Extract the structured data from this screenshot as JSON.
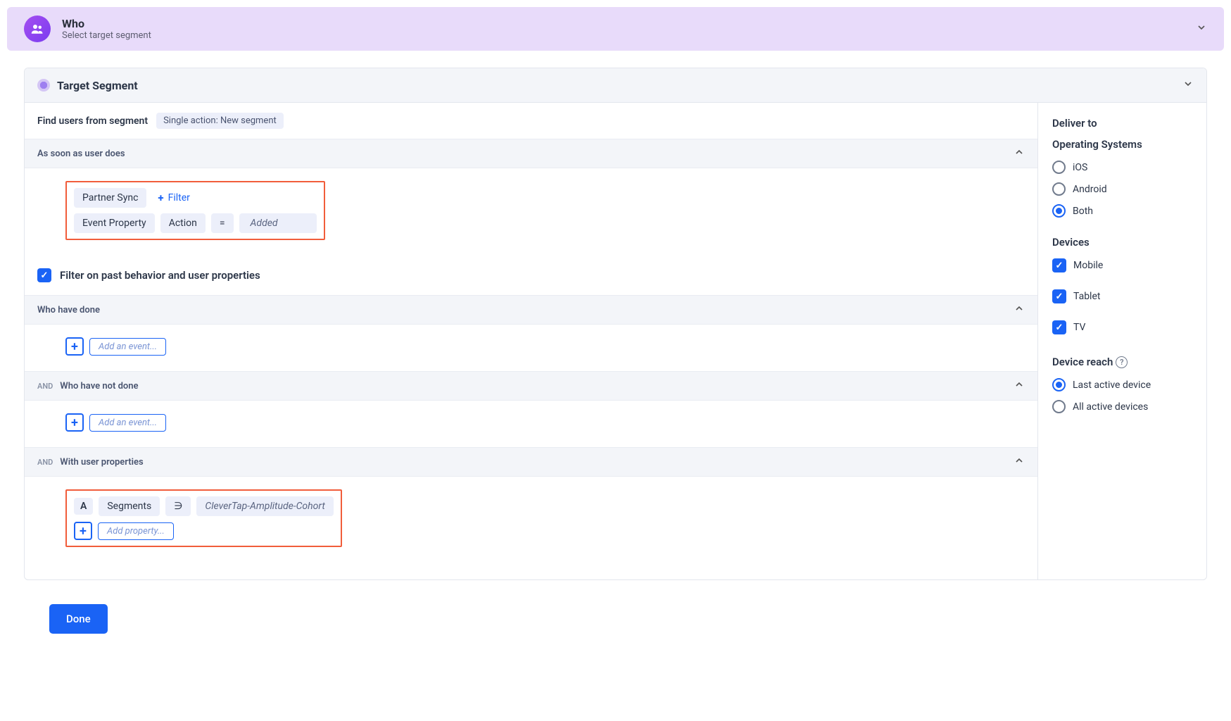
{
  "banner": {
    "title": "Who",
    "subtitle": "Select target segment"
  },
  "target_segment": {
    "title": "Target Segment",
    "find_label": "Find users from segment",
    "find_badge": "Single action: New segment",
    "as_soon_as": {
      "title": "As soon as user does",
      "event": "Partner Sync",
      "filter_label": "Filter",
      "prop_label": "Event Property",
      "prop_key": "Action",
      "op": "=",
      "prop_value": "Added"
    },
    "filter_behavior": {
      "label": "Filter on past behavior and user properties"
    },
    "done_section": {
      "title": "Who have done",
      "placeholder": "Add an event..."
    },
    "notdone_section": {
      "and": "AND",
      "title": "Who have not done",
      "placeholder": "Add an event..."
    },
    "userprops_section": {
      "and": "AND",
      "title": "With user properties",
      "letter": "A",
      "key": "Segments",
      "op": "∋",
      "value": "CleverTap-Amplitude-Cohort",
      "placeholder": "Add property..."
    }
  },
  "deliver": {
    "title": "Deliver to",
    "os_title": "Operating Systems",
    "os": {
      "ios": "iOS",
      "android": "Android",
      "both": "Both"
    },
    "devices_title": "Devices",
    "devices": {
      "mobile": "Mobile",
      "tablet": "Tablet",
      "tv": "TV"
    },
    "reach_title": "Device reach",
    "reach": {
      "last": "Last active device",
      "all": "All active devices"
    }
  },
  "done_btn": "Done"
}
